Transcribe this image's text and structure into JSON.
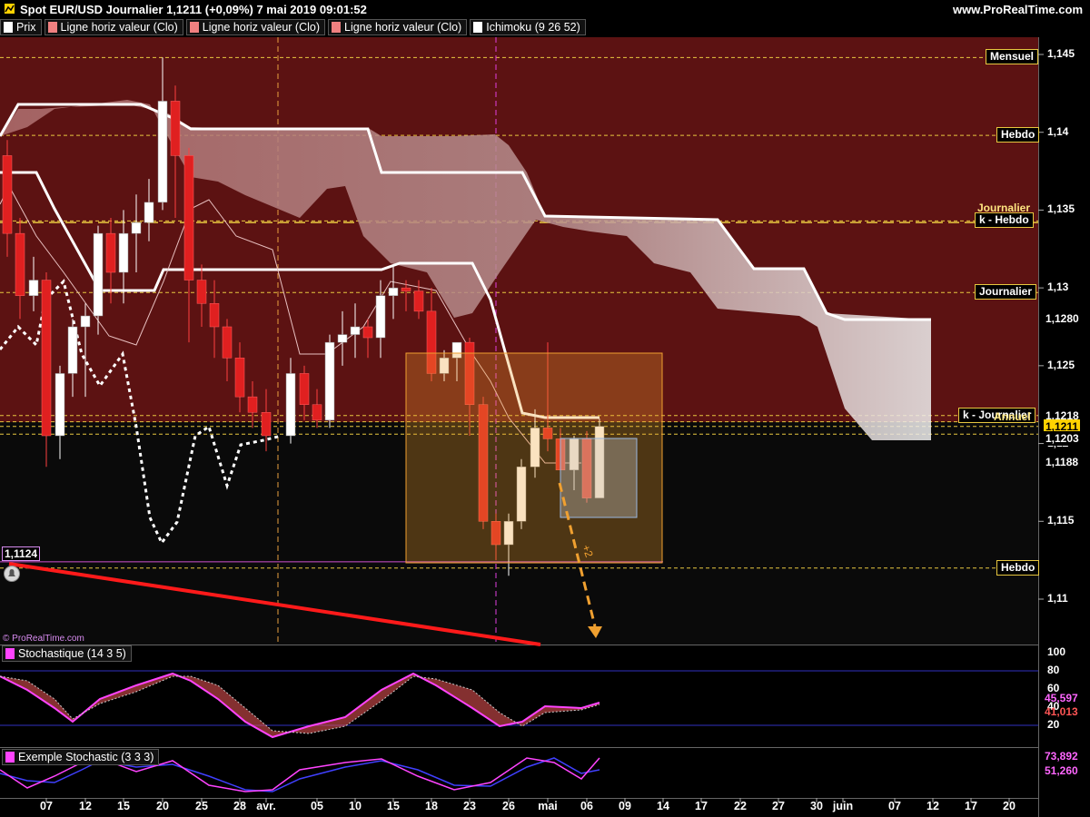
{
  "window": {
    "title": "Spot EUR/USD Journalier 1,1211 (+0,09%) 7 mai 2019 09:01:52",
    "site": "www.ProRealTime.com"
  },
  "legend": [
    {
      "label": "Prix",
      "color": "#ffffff"
    },
    {
      "label": "Ligne horiz valeur (Clo)",
      "color": "#f08080"
    },
    {
      "label": "Ligne horiz valeur (Clo)",
      "color": "#f08080"
    },
    {
      "label": "Ligne horiz valeur (Clo)",
      "color": "#f08080"
    },
    {
      "label": "Ichimoku (9 26 52)",
      "color": "#ffffff"
    }
  ],
  "price_axis": {
    "ticks": [
      "1,145",
      "1,14",
      "1,135",
      "1,13",
      "1,125",
      "1,12",
      "1,115",
      "1,11"
    ],
    "markers": [
      {
        "label": "1,1280",
        "value": 1.128,
        "bg": "#000000",
        "fg": "#ffffff"
      },
      {
        "label": "1,1218",
        "value": 1.1218,
        "bg": "#000000",
        "fg": "#ffffff"
      },
      {
        "label": "1,1211",
        "value": 1.1211,
        "bg": "#ffd200",
        "fg": "#000000"
      },
      {
        "label": "1,1203",
        "value": 1.1203,
        "bg": "#000000",
        "fg": "#ffffff"
      },
      {
        "label": "1,1188",
        "value": 1.1188,
        "bg": "#000000",
        "fg": "#ffffff"
      }
    ],
    "left_marker": {
      "label": "1,1124",
      "value": 1.1124
    }
  },
  "levels": [
    {
      "label": "Mensuel",
      "value": 1.1448
    },
    {
      "label": "Hebdo",
      "value": 1.1398
    },
    {
      "label": "Journalier",
      "value": 1.1297
    },
    {
      "label": "k - Hebdo",
      "value": 1.1343
    },
    {
      "label": "k - Journalier",
      "value": 1.1218
    },
    {
      "label": "Hebdo",
      "value": 1.112
    }
  ],
  "hidden_level_labels": [
    "Journalier",
    "Annuel"
  ],
  "copyright": "© ProRealTime.com",
  "stochastic": {
    "title": "Stochastique (14 3 5)",
    "color": "#ff44ff",
    "ticks": [
      "100",
      "80",
      "60",
      "40",
      "20"
    ],
    "value1": "45,597",
    "value2": "41,013"
  },
  "example_stochastic": {
    "title": "Exemple Stochastic (3 3 3)",
    "color": "#ff44ff",
    "value1": "73,892",
    "value2": "51,260"
  },
  "x_axis": {
    "labels": [
      "07",
      "12",
      "15",
      "20",
      "25",
      "28",
      "avr.",
      "05",
      "10",
      "15",
      "18",
      "23",
      "26",
      "mai",
      "06",
      "09",
      "14",
      "17",
      "22",
      "27",
      "30",
      "juin",
      "07",
      "12",
      "17",
      "20"
    ]
  },
  "annotation": {
    "label": "+2"
  },
  "colors": {
    "bullish_zone": "#5c1212",
    "bear_candle": "#e02020",
    "bull_candle": "#ffffff",
    "cloud": "#c8c8c8",
    "trendline": "#ff1a1a",
    "level_line": "#e8c840",
    "zone_box": "#f0a030"
  }
}
